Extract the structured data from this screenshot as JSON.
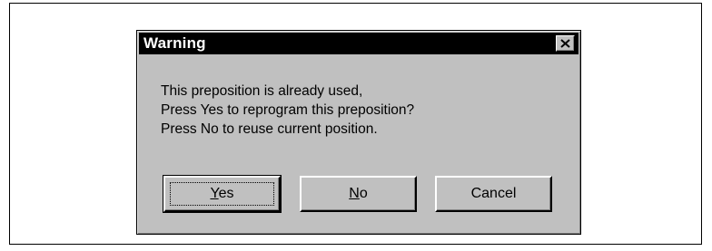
{
  "dialog": {
    "title": "Warning",
    "close_icon": "close-icon",
    "message_lines": [
      "This preposition is already used,",
      "Press Yes to reprogram this preposition?",
      "Press No to reuse current position."
    ],
    "buttons": {
      "yes": {
        "mnemonic": "Y",
        "rest": "es"
      },
      "no": {
        "mnemonic": "N",
        "rest": "o"
      },
      "cancel": {
        "label": "Cancel"
      }
    }
  },
  "colors": {
    "dialog_face": "#c0c0c0",
    "titlebar": "#000000",
    "title_text": "#ffffff"
  }
}
